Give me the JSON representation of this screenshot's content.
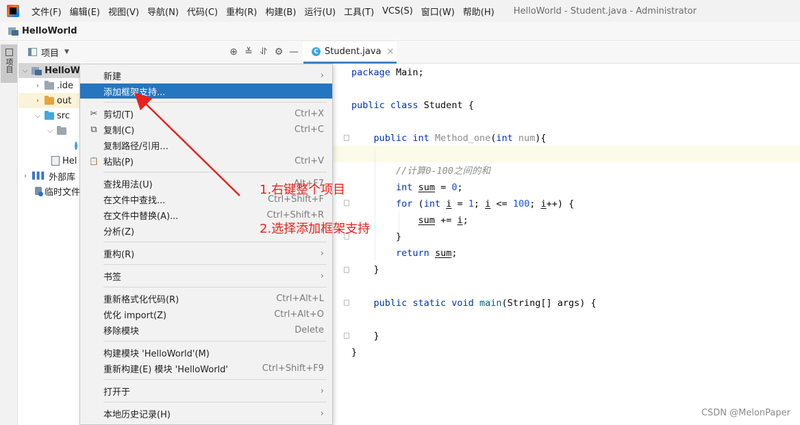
{
  "menubar": {
    "items": [
      "文件(F)",
      "编辑(E)",
      "视图(V)",
      "导航(N)",
      "代码(C)",
      "重构(R)",
      "构建(B)",
      "运行(U)",
      "工具(T)",
      "VCS(S)",
      "窗口(W)",
      "帮助(H)"
    ],
    "window_title": "HelloWorld - Student.java - Administrator"
  },
  "navbar": {
    "project_name": "HelloWorld"
  },
  "left_strip": {
    "tab_label": "项目"
  },
  "project_panel": {
    "title": "项目"
  },
  "tree": [
    {
      "label": "HelloW",
      "bold": true
    },
    {
      "label": ".ide"
    },
    {
      "label": "out"
    },
    {
      "label": "src"
    },
    {
      "label": ""
    },
    {
      "label": ""
    },
    {
      "label": "Hel"
    },
    {
      "label": "外部库"
    },
    {
      "label": "临时文件"
    }
  ],
  "editor": {
    "tab_label": "Student.java"
  },
  "context_menu": {
    "items": [
      {
        "label": "新建",
        "submenu": true
      },
      {
        "label": "添加框架支持...",
        "highlighted": true
      },
      {
        "label": "剪切(T)",
        "shortcut": "Ctrl+X",
        "icon": "✂"
      },
      {
        "label": "复制(C)",
        "shortcut": "Ctrl+C",
        "icon": "⧉"
      },
      {
        "label": "复制路径/引用..."
      },
      {
        "label": "粘贴(P)",
        "shortcut": "Ctrl+V",
        "icon": "📋"
      },
      {
        "label": "查找用法(U)",
        "shortcut": "Alt+F7"
      },
      {
        "label": "在文件中查找...",
        "shortcut": "Ctrl+Shift+F"
      },
      {
        "label": "在文件中替换(A)...",
        "shortcut": "Ctrl+Shift+R"
      },
      {
        "label": "分析(Z)",
        "submenu": true
      },
      {
        "label": "重构(R)",
        "submenu": true
      },
      {
        "label": "书签",
        "submenu": true
      },
      {
        "label": "重新格式化代码(R)",
        "shortcut": "Ctrl+Alt+L"
      },
      {
        "label": "优化 import(Z)",
        "shortcut": "Ctrl+Alt+O"
      },
      {
        "label": "移除模块",
        "shortcut": "Delete"
      },
      {
        "label": "构建模块 'HelloWorld'(M)"
      },
      {
        "label": "重新构建(E) 模块 'HelloWorld'",
        "shortcut": "Ctrl+Shift+F9"
      },
      {
        "label": "打开于",
        "submenu": true
      },
      {
        "label": "本地历史记录(H)",
        "submenu": true
      }
    ],
    "submenu_arrow": "›"
  },
  "annotations": [
    "1.右键整个项目",
    "2.选择添加框架支持"
  ],
  "watermark": "CSDN @MelonPaper",
  "colors": {
    "menu_highlight": "#2675bf",
    "annotation_red": "#e8221c",
    "keyword": "#0033b3",
    "tab_underline": "#4083c9"
  }
}
